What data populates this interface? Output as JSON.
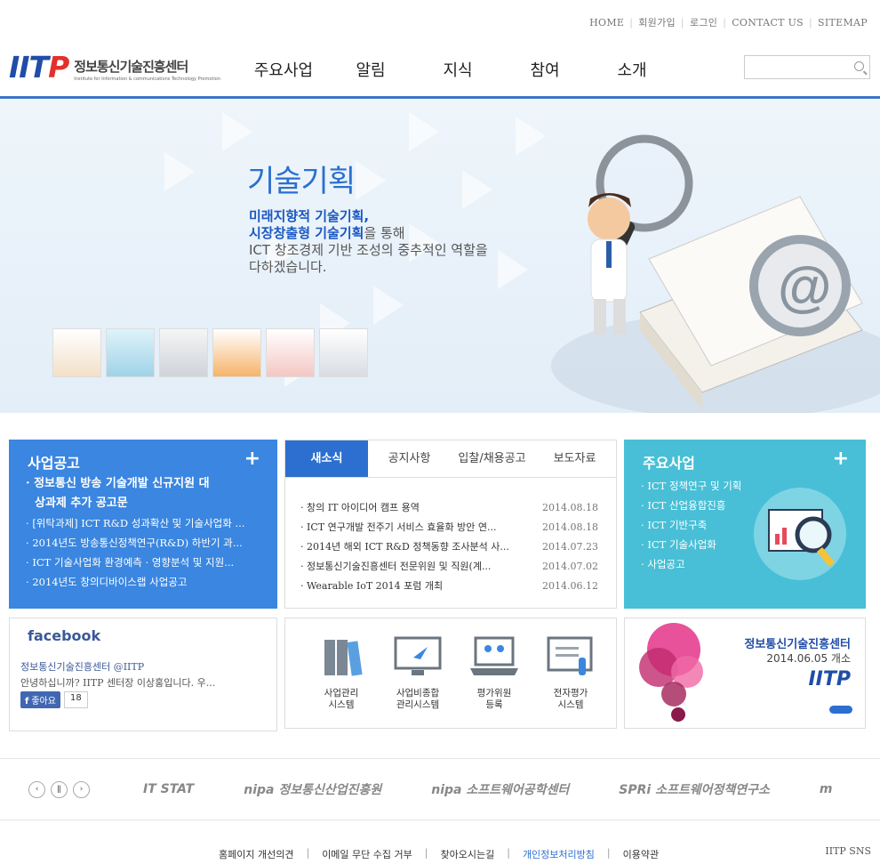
{
  "top_links": [
    "HOME",
    "회원가입",
    "로그인",
    "CONTACT US",
    "SITEMAP"
  ],
  "logo": {
    "mark_blue": "IIT",
    "mark_red": "P",
    "name_kr": "정보통신기술진흥센터",
    "name_en": "Institute for Information & communications Technology Promotion"
  },
  "gnb": [
    "주요사업",
    "알림",
    "지식",
    "참여",
    "소개"
  ],
  "search": {
    "placeholder": ""
  },
  "hero": {
    "title": "기술기획",
    "line1": "미래지향적 기술기획,",
    "line2_bold": "시장창출형 기술기획",
    "line2_rest": "을 통해",
    "line3": "ICT 창조경제 기반 조성의 중추적인 역할을",
    "line4": "다하겠습니다."
  },
  "notice": {
    "title": "사업공고",
    "plus": "+",
    "items": [
      "정보통신 방송 기술개발 신규지원 대",
      "상과제 추가 공고문",
      "[위탁과제] ICT R&D 성과확산 및 기술사업화 ...",
      "2014년도 방송통신정책연구(R&D) 하반기 과...",
      "ICT 기술사업화 환경예측 · 영향분석 및 지원...",
      "2014년도 창의디바이스랩 사업공고"
    ]
  },
  "news": {
    "tabs": [
      "새소식",
      "공지사항",
      "입찰/채용공고",
      "보도자료"
    ],
    "items": [
      {
        "title": "창의 IT 아이디어 캠프 용역",
        "date": "2014.08.18"
      },
      {
        "title": "ICT 연구개발 전주기 서비스 효율화 방안 연...",
        "date": "2014.08.18"
      },
      {
        "title": "2014년 해외 ICT R&D 정책동향 조사분석 사...",
        "date": "2014.07.23"
      },
      {
        "title": "정보통신기술진흥센터 전문위원 및 직원(계...",
        "date": "2014.07.02"
      },
      {
        "title": "Wearable IoT 2014 포럼 개최",
        "date": "2014.06.12"
      }
    ]
  },
  "business": {
    "title": "주요사업",
    "plus": "+",
    "items": [
      "ICT 정책연구 및 기획",
      "ICT 산업융합진흥",
      "ICT 기반구축",
      "ICT 기술사업화",
      "사업공고"
    ]
  },
  "facebook": {
    "title": "facebook",
    "page": "정보통신기술진흥센터 @IITP",
    "text": "안녕하십니까? IITP 센터장 이상홍입니다. 우...",
    "like": "좋아요",
    "count": "18"
  },
  "systems": [
    {
      "l1": "사업관리",
      "l2": "시스템"
    },
    {
      "l1": "사업비종합",
      "l2": "관리시스템"
    },
    {
      "l1": "평가위원",
      "l2": "등록"
    },
    {
      "l1": "전자평가",
      "l2": "시스템"
    }
  ],
  "opening": {
    "name": "정보통신기술진흥센터",
    "date": "2014.06.05 개소",
    "mark": "IITP"
  },
  "partners": [
    "IT STAT",
    "nipa 정보통신산업진흥원",
    "nipa 소프트웨어공학센터",
    "SPRi 소프트웨어정책연구소",
    "m"
  ],
  "footer": [
    "홈페이지 개선의견",
    "이메일 무단 수집 거부",
    "찾아오시는길",
    "개인정보처리방침",
    "이용약관"
  ],
  "sns": "IITP SNS",
  "colors": {
    "primary": "#2d6fd0",
    "notice": "#3a86e0",
    "business": "#48bfd6",
    "privacy": "#2d6fd0"
  }
}
